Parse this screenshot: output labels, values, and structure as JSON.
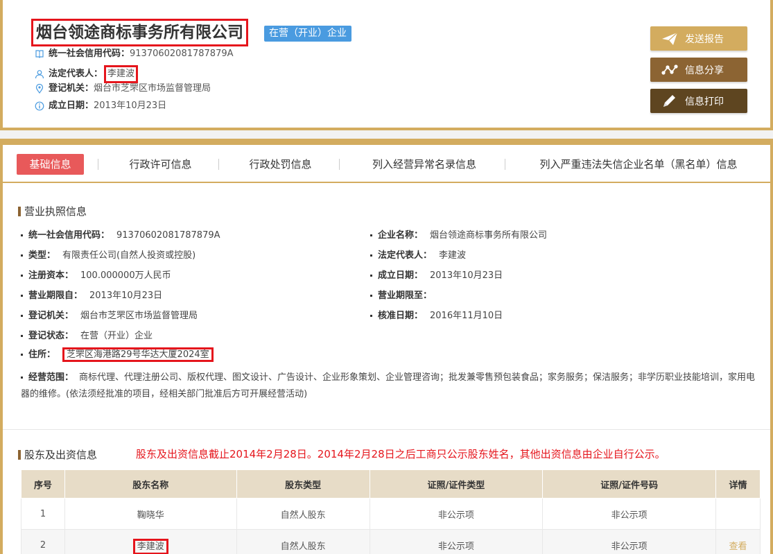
{
  "header": {
    "company_name": "烟台领途商标事务所有限公司",
    "status": "在营（开业）企业",
    "credit_code_label": "统一社会信用代码：",
    "credit_code": "91370602081787879A",
    "legal_rep_label": "法定代表人：",
    "legal_rep": "李建波",
    "authority_label": "登记机关：",
    "authority": "烟台市芝罘区市场监督管理局",
    "established_label": "成立日期：",
    "established": "2013年10月23日"
  },
  "actions": {
    "report": "发送报告",
    "share": "信息分享",
    "print": "信息打印"
  },
  "tabs": [
    "基础信息",
    "行政许可信息",
    "行政处罚信息",
    "列入经营异常名录信息",
    "列入严重违法失信企业名单（黑名单）信息"
  ],
  "license": {
    "title": "营业执照信息",
    "left": [
      {
        "k": "统一社会信用代码：",
        "v": "91370602081787879A"
      },
      {
        "k": "类型：",
        "v": "有限责任公司(自然人投资或控股)"
      },
      {
        "k": "注册资本：",
        "v": "100.000000万人民币"
      },
      {
        "k": "营业期限自：",
        "v": "2013年10月23日"
      },
      {
        "k": "登记机关：",
        "v": "烟台市芝罘区市场监督管理局"
      },
      {
        "k": "登记状态：",
        "v": "在营（开业）企业"
      },
      {
        "k": "住所：",
        "v": "芝罘区海港路29号华达大厦2024室"
      }
    ],
    "right": [
      {
        "k": "企业名称：",
        "v": "烟台领途商标事务所有限公司"
      },
      {
        "k": "法定代表人：",
        "v": "李建波"
      },
      {
        "k": "成立日期：",
        "v": "2013年10月23日"
      },
      {
        "k": "营业期限至：",
        "v": ""
      },
      {
        "k": "核准日期：",
        "v": "2016年11月10日"
      }
    ],
    "scope_label": "经营范围：",
    "scope": "商标代理、代理注册公司、版权代理、图文设计、广告设计、企业形象策划、企业管理咨询；批发兼零售预包装食品；家务服务；保洁服务；非学历职业技能培训，家用电器的维修。(依法须经批准的项目，经相关部门批准后方可开展经营活动)"
  },
  "shareholders": {
    "title": "股东及出资信息",
    "note": "股东及出资信息截止2014年2月28日。2014年2月28日之后工商只公示股东姓名，其他出资信息由企业自行公示。",
    "columns": [
      "序号",
      "股东名称",
      "股东类型",
      "证照/证件类型",
      "证照/证件号码",
      "详情"
    ],
    "rows": [
      {
        "no": "1",
        "name": "鞠晓华",
        "type": "自然人股东",
        "id_type": "非公示项",
        "id_no": "非公示项",
        "detail": ""
      },
      {
        "no": "2",
        "name": "李建波",
        "type": "自然人股东",
        "id_type": "非公示项",
        "id_no": "非公示项",
        "detail": "查看"
      }
    ]
  },
  "colors": {
    "gold": "#d3ac5f",
    "brown": "#8c6433",
    "dark_brown": "#5e4520",
    "active_tab": "#e8595a",
    "status_blue": "#4a9be0",
    "highlight_red": "#e5151c"
  }
}
